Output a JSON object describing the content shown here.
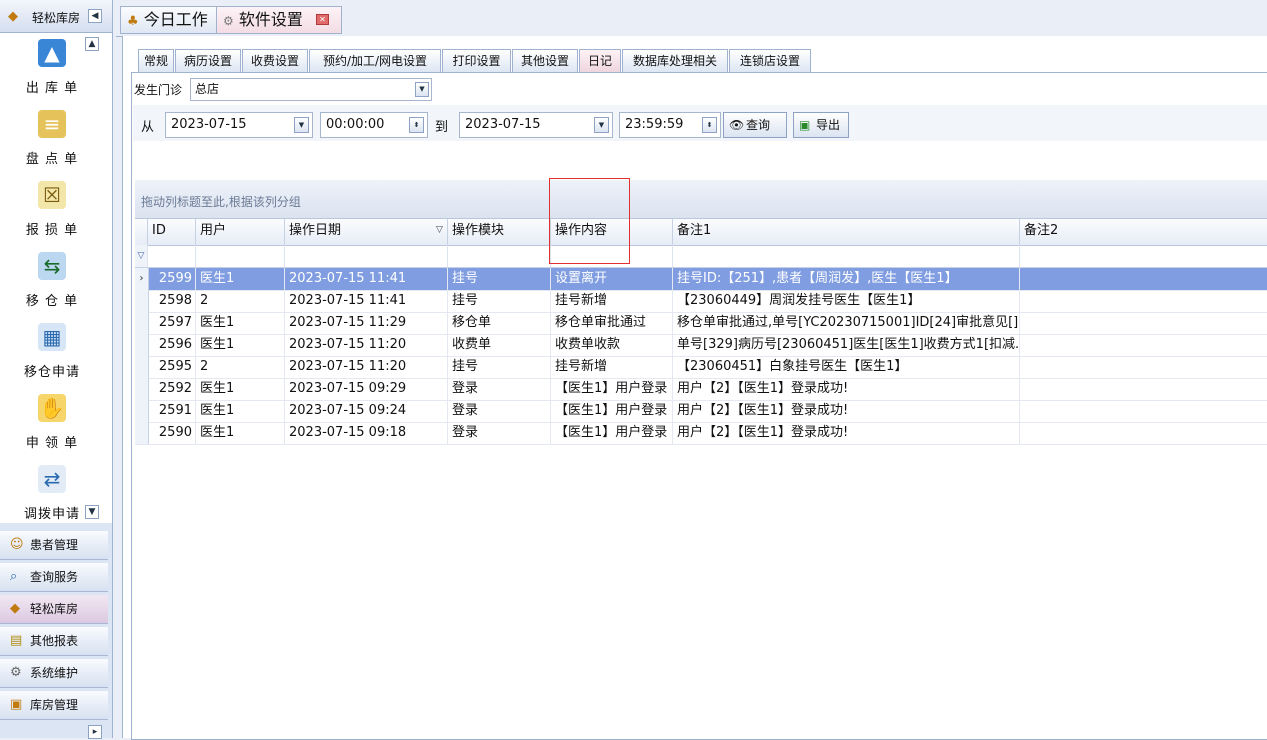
{
  "sidebar": {
    "title": "轻松库房",
    "items": [
      {
        "label": "出 库 单",
        "icon": "outbound-icon"
      },
      {
        "label": "盘 点 单",
        "icon": "inventory-icon"
      },
      {
        "label": "报 损 单",
        "icon": "damage-report-icon"
      },
      {
        "label": "移 仓 单",
        "icon": "transfer-icon"
      },
      {
        "label": "移仓申请",
        "icon": "transfer-request-icon"
      },
      {
        "label": "申 领 单",
        "icon": "requisition-icon"
      },
      {
        "label": "调拨申请",
        "icon": "allocation-icon"
      }
    ],
    "groups": [
      {
        "label": "患者管理",
        "icon": "patients-icon"
      },
      {
        "label": "查询服务",
        "icon": "query-icon"
      },
      {
        "label": "轻松库房",
        "icon": "warehouse-icon"
      },
      {
        "label": "其他报表",
        "icon": "reports-icon"
      },
      {
        "label": "系统维护",
        "icon": "maintenance-icon"
      },
      {
        "label": "库房管理",
        "icon": "storage-icon"
      }
    ]
  },
  "top_tabs": [
    {
      "label": "今日工作",
      "icon": "work-icon"
    },
    {
      "label": "软件设置",
      "icon": "settings-icon"
    }
  ],
  "settings_tabs": [
    "常规",
    "病历设置",
    "收费设置",
    "预约/加工/网电设置",
    "打印设置",
    "其他设置",
    "日记",
    "数据库处理相关",
    "连锁店设置"
  ],
  "clinic": {
    "label": "发生门诊",
    "value": "总店"
  },
  "filter": {
    "from_label": "从",
    "from_date": "2023-07-15",
    "from_time": "00:00:00",
    "to_label": "到",
    "to_date": "2023-07-15",
    "to_time": "23:59:59",
    "query_label": "查询",
    "export_label": "导出"
  },
  "grid": {
    "group_hint": "拖动列标题至此,根据该列分组",
    "columns": [
      "ID",
      "用户",
      "操作日期",
      "操作模块",
      "操作内容",
      "备注1",
      "备注2"
    ],
    "rows": [
      {
        "id": "2599",
        "user": "医生1",
        "date": "2023-07-15 11:41",
        "module": "挂号",
        "content": "设置离开",
        "note1": "挂号ID:【251】,患者【周润发】,医生【医生1】",
        "note2": ""
      },
      {
        "id": "2598",
        "user": "2",
        "date": "2023-07-15 11:41",
        "module": "挂号",
        "content": "挂号新增",
        "note1": "【23060449】周润发挂号医生【医生1】",
        "note2": ""
      },
      {
        "id": "2597",
        "user": "医生1",
        "date": "2023-07-15 11:29",
        "module": "移仓单",
        "content": "移仓单审批通过",
        "note1": "移仓单审批通过,单号[YC20230715001]ID[24]审批意见[]",
        "note2": ""
      },
      {
        "id": "2596",
        "user": "医生1",
        "date": "2023-07-15 11:20",
        "module": "收费单",
        "content": "收费单收款",
        "note1": "单号[329]病历号[23060451]医生[医生1]收费方式1[扣减...",
        "note2": ""
      },
      {
        "id": "2595",
        "user": "2",
        "date": "2023-07-15 11:20",
        "module": "挂号",
        "content": "挂号新增",
        "note1": "【23060451】白象挂号医生【医生1】",
        "note2": ""
      },
      {
        "id": "2592",
        "user": "医生1",
        "date": "2023-07-15 09:29",
        "module": "登录",
        "content": "【医生1】用户登录",
        "note1": "用户【2】【医生1】登录成功!",
        "note2": ""
      },
      {
        "id": "2591",
        "user": "医生1",
        "date": "2023-07-15 09:24",
        "module": "登录",
        "content": "【医生1】用户登录",
        "note1": "用户【2】【医生1】登录成功!",
        "note2": ""
      },
      {
        "id": "2590",
        "user": "医生1",
        "date": "2023-07-15 09:18",
        "module": "登录",
        "content": "【医生1】用户登录",
        "note1": "用户【2】【医生1】登录成功!",
        "note2": ""
      }
    ]
  },
  "colors": {
    "selected_row": "#7f9de0",
    "highlight_box": "#e0302f"
  }
}
